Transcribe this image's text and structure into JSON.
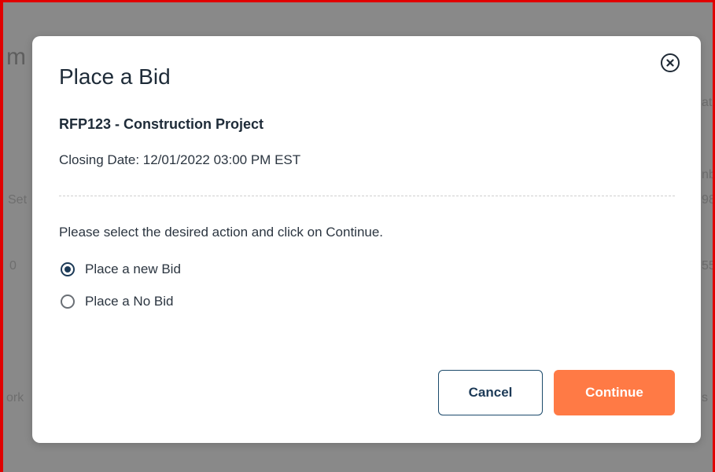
{
  "background": {
    "title_fragment": "m",
    "left_fragments": [
      "Set",
      "0",
      "ork"
    ],
    "right_fragments": [
      "at",
      "nb",
      "98",
      "55",
      "s"
    ]
  },
  "modal": {
    "title": "Place a Bid",
    "rfp_title": "RFP123 - Construction Project",
    "closing_date": "Closing Date: 12/01/2022 03:00 PM EST",
    "instruction": "Please select the desired action and click on Continue.",
    "options": [
      {
        "label": "Place a new Bid",
        "selected": true
      },
      {
        "label": "Place a No Bid",
        "selected": false
      }
    ],
    "cancel_label": "Cancel",
    "continue_label": "Continue",
    "close_icon": "close-circle-icon"
  },
  "colors": {
    "accent": "#ff7a45",
    "primary_text": "#1e2b38",
    "primary_outline": "#1c4a6b",
    "backdrop": "#898989",
    "frame_border": "#e00000"
  }
}
